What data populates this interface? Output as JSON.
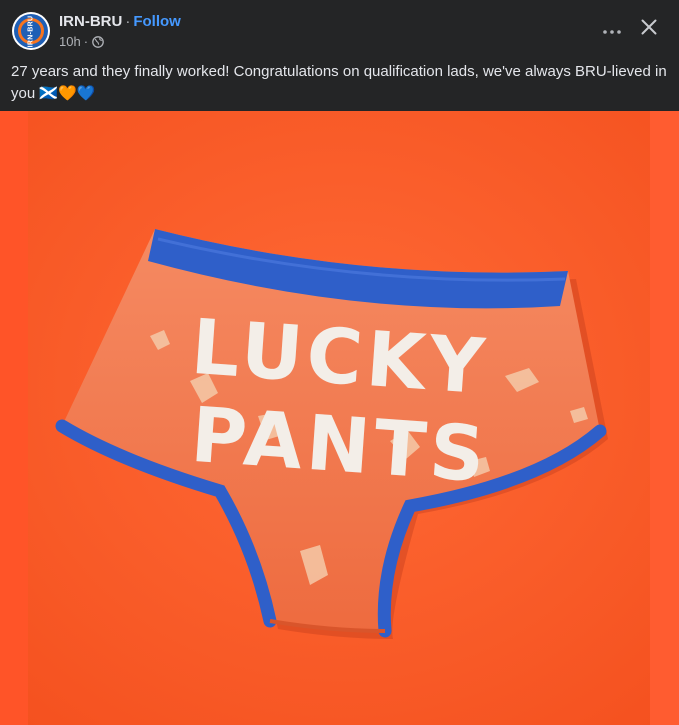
{
  "post": {
    "page_name": "IRN-BRU",
    "separator": "·",
    "follow_label": "Follow",
    "time": "10h",
    "time_separator": "·",
    "caption": "27 years and they finally worked! Congratulations on qualification lads, we've always BRU-lieved in you 🏴󠁧󠁢󠁳󠁣󠁴󠁿🧡💙",
    "avatar_text": "IRN-BRU"
  },
  "photo": {
    "pants_text_line1": "LUCKY",
    "pants_text_line2": "PANTS"
  },
  "icons": {
    "globe": "globe-icon",
    "more": "more-icon",
    "close": "close-icon"
  },
  "colors": {
    "background": "#242526",
    "photo_orange": "#ff5a2a",
    "pants_orange": "#f47a4e",
    "waistband_blue": "#2f5fc9",
    "follow_blue": "#4599ff"
  }
}
